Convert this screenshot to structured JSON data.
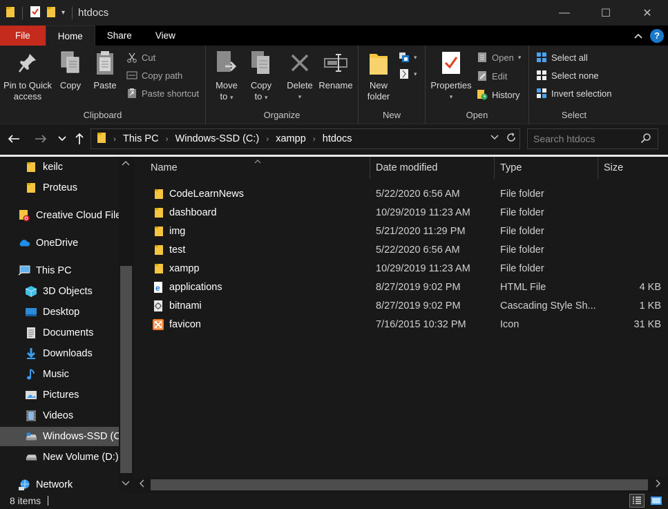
{
  "window": {
    "title": "htdocs",
    "minimize": "—",
    "maximize": "☐",
    "close": "✕"
  },
  "tabs": [
    {
      "label": "File"
    },
    {
      "label": "Home"
    },
    {
      "label": "Share"
    },
    {
      "label": "View"
    }
  ],
  "ribbon": {
    "clipboard": {
      "label": "Clipboard",
      "pin_l1": "Pin to Quick",
      "pin_l2": "access",
      "copy": "Copy",
      "paste": "Paste",
      "cut": "Cut",
      "copy_path": "Copy path",
      "paste_shortcut": "Paste shortcut"
    },
    "organize": {
      "label": "Organize",
      "move_l1": "Move",
      "move_l2": "to",
      "copy_l1": "Copy",
      "copy_l2": "to",
      "delete": "Delete",
      "rename": "Rename"
    },
    "new": {
      "label": "New",
      "new_folder_l1": "New",
      "new_folder_l2": "folder"
    },
    "open": {
      "label": "Open",
      "properties": "Properties",
      "open": "Open",
      "edit": "Edit",
      "history": "History"
    },
    "select": {
      "label": "Select",
      "select_all": "Select all",
      "select_none": "Select none",
      "invert": "Invert selection"
    }
  },
  "address": {
    "crumbs": [
      "This PC",
      "Windows-SSD (C:)",
      "xampp",
      "htdocs"
    ],
    "search_placeholder": "Search htdocs"
  },
  "nav": [
    {
      "label": "keilc",
      "icon": "folder-icon"
    },
    {
      "label": "Proteus",
      "icon": "folder-icon"
    },
    {
      "label": "Creative Cloud File",
      "icon": "creative-cloud-icon"
    },
    {
      "label": "OneDrive",
      "icon": "onedrive-icon"
    },
    {
      "label": "This PC",
      "icon": "computer-icon"
    },
    {
      "label": "3D Objects",
      "icon": "3d-objects-icon"
    },
    {
      "label": "Desktop",
      "icon": "desktop-icon"
    },
    {
      "label": "Documents",
      "icon": "documents-icon"
    },
    {
      "label": "Downloads",
      "icon": "downloads-icon"
    },
    {
      "label": "Music",
      "icon": "music-icon"
    },
    {
      "label": "Pictures",
      "icon": "pictures-icon"
    },
    {
      "label": "Videos",
      "icon": "videos-icon"
    },
    {
      "label": "Windows-SSD (C",
      "icon": "drive-icon"
    },
    {
      "label": "New Volume (D:)",
      "icon": "drive-icon"
    },
    {
      "label": "Network",
      "icon": "network-icon"
    }
  ],
  "columns": {
    "name": "Name",
    "date": "Date modified",
    "type": "Type",
    "size": "Size"
  },
  "files": [
    {
      "name": "CodeLearnNews",
      "date": "5/22/2020 6:56 AM",
      "type": "File folder",
      "size": "",
      "icon": "folder-icon"
    },
    {
      "name": "dashboard",
      "date": "10/29/2019 11:23 AM",
      "type": "File folder",
      "size": "",
      "icon": "folder-icon"
    },
    {
      "name": "img",
      "date": "5/21/2020 11:29 PM",
      "type": "File folder",
      "size": "",
      "icon": "folder-icon"
    },
    {
      "name": "test",
      "date": "5/22/2020 6:56 AM",
      "type": "File folder",
      "size": "",
      "icon": "folder-icon"
    },
    {
      "name": "xampp",
      "date": "10/29/2019 11:23 AM",
      "type": "File folder",
      "size": "",
      "icon": "folder-icon"
    },
    {
      "name": "applications",
      "date": "8/27/2019 9:02 PM",
      "type": "HTML File",
      "size": "4 KB",
      "icon": "html-file-icon"
    },
    {
      "name": "bitnami",
      "date": "8/27/2019 9:02 PM",
      "type": "Cascading Style Sh...",
      "size": "1 KB",
      "icon": "css-file-icon"
    },
    {
      "name": "favicon",
      "date": "7/16/2015 10:32 PM",
      "type": "Icon",
      "size": "31 KB",
      "icon": "xampp-icon"
    }
  ],
  "status": {
    "count": "8 items"
  },
  "colors": {
    "file_tab": "#c42b1c",
    "folder": "#f5c542",
    "accent": "#1979ca",
    "xampp": "#fb7a24"
  }
}
